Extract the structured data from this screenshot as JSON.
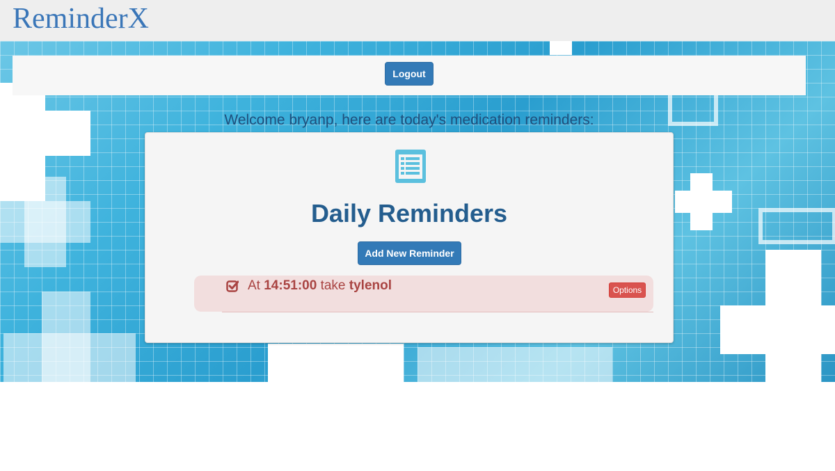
{
  "brand": "ReminderX",
  "nav": {
    "logout_label": "Logout"
  },
  "welcome": {
    "prefix": "Welcome ",
    "username": "bryanp",
    "suffix": ", here are today's medication reminders:"
  },
  "card": {
    "icon": "list-icon",
    "title": "Daily Reminders",
    "add_button_label": "Add New Reminder"
  },
  "reminders": [
    {
      "icon": "checkbox-checked-icon",
      "at_label": "At ",
      "time": "14:51:00",
      "take_label": " take ",
      "medication": "tylenol",
      "options_label": "Options"
    }
  ],
  "colors": {
    "brand": "#3a76b8",
    "primary": "#337ab7",
    "danger": "#d9534f",
    "reminder_bg": "#f2dede",
    "reminder_text": "#a94442",
    "title": "#245d8e"
  }
}
